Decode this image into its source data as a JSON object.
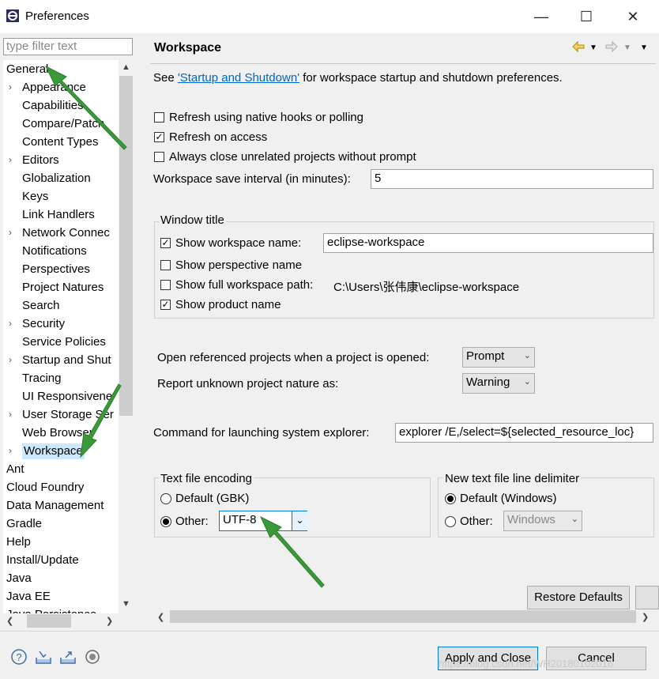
{
  "window": {
    "title": "Preferences",
    "minimize": "—",
    "maximize": "☐",
    "close": "✕"
  },
  "filter": {
    "placeholder": "type filter text"
  },
  "tree": [
    {
      "label": "General",
      "level": 0,
      "expanded": true
    },
    {
      "label": "Appearance",
      "level": 1,
      "toggle": "›"
    },
    {
      "label": "Capabilities",
      "level": 1
    },
    {
      "label": "Compare/Patch",
      "level": 1
    },
    {
      "label": "Content Types",
      "level": 1
    },
    {
      "label": "Editors",
      "level": 1,
      "toggle": "›"
    },
    {
      "label": "Globalization",
      "level": 1
    },
    {
      "label": "Keys",
      "level": 1
    },
    {
      "label": "Link Handlers",
      "level": 1
    },
    {
      "label": "Network Connec",
      "level": 1,
      "toggle": "›"
    },
    {
      "label": "Notifications",
      "level": 1
    },
    {
      "label": "Perspectives",
      "level": 1
    },
    {
      "label": "Project Natures",
      "level": 1
    },
    {
      "label": "Search",
      "level": 1
    },
    {
      "label": "Security",
      "level": 1,
      "toggle": "›"
    },
    {
      "label": "Service Policies",
      "level": 1
    },
    {
      "label": "Startup and Shut",
      "level": 1,
      "toggle": "›"
    },
    {
      "label": "Tracing",
      "level": 1
    },
    {
      "label": "UI Responsivene",
      "level": 1
    },
    {
      "label": "User Storage Ser",
      "level": 1,
      "toggle": "›"
    },
    {
      "label": "Web Browser",
      "level": 1
    },
    {
      "label": "Workspace",
      "level": 1,
      "toggle": "›",
      "selected": true
    },
    {
      "label": "Ant",
      "level": 0
    },
    {
      "label": "Cloud Foundry",
      "level": 0
    },
    {
      "label": "Data Management",
      "level": 0
    },
    {
      "label": "Gradle",
      "level": 0
    },
    {
      "label": "Help",
      "level": 0
    },
    {
      "label": "Install/Update",
      "level": 0
    },
    {
      "label": "Java",
      "level": 0
    },
    {
      "label": "Java EE",
      "level": 0
    },
    {
      "label": "Java Persistence",
      "level": 0
    }
  ],
  "page": {
    "title": "Workspace",
    "see_prefix": "See ",
    "see_link": "'Startup and Shutdown'",
    "see_suffix": " for workspace startup and shutdown preferences.",
    "refresh_native": "Refresh using native hooks or polling",
    "refresh_access": "Refresh on access",
    "always_close": "Always close unrelated projects without prompt",
    "save_interval_label": "Workspace save interval (in minutes):",
    "save_interval_value": "5",
    "window_title": {
      "legend": "Window title",
      "show_ws_name": "Show workspace name:",
      "ws_name_value": "eclipse-workspace",
      "show_perspective": "Show perspective name",
      "show_full_path": "Show full workspace path:",
      "full_path_value": "C:\\Users\\张伟康\\eclipse-workspace",
      "show_product": "Show product name"
    },
    "open_ref_label": "Open referenced projects when a project is opened:",
    "open_ref_value": "Prompt",
    "unknown_nature_label": "Report unknown project nature as:",
    "unknown_nature_value": "Warning",
    "cmd_label": "Command for launching system explorer:",
    "cmd_value": "explorer /E,/select=${selected_resource_loc}",
    "encoding": {
      "legend": "Text file encoding",
      "default": "Default (GBK)",
      "other": "Other:",
      "other_value": "UTF-8"
    },
    "delimiter": {
      "legend": "New text file line delimiter",
      "default": "Default (Windows)",
      "other": "Other:",
      "other_value": "Windows"
    },
    "restore_defaults": "Restore Defaults"
  },
  "footer": {
    "apply_close": "Apply and Close",
    "cancel": "Cancel",
    "watermark": "https://blog.csdn.net/WH20180102016"
  },
  "icons": [
    "app-icon",
    "back-icon",
    "forward-icon",
    "help-icon",
    "import-icon",
    "export-icon",
    "record-icon"
  ]
}
